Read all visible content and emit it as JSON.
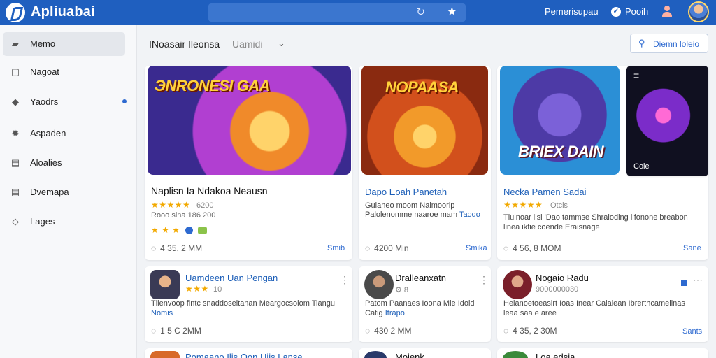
{
  "app": {
    "title": "Apliuabai"
  },
  "header": {
    "search_placeholder": "",
    "link1": "Pemerisupau",
    "link2": "Pooih"
  },
  "sidebar": {
    "items": [
      {
        "label": "Memo",
        "icon": "store-icon",
        "glyph": "▰",
        "active": true
      },
      {
        "label": "Nagoat",
        "icon": "window-icon",
        "glyph": "▢"
      },
      {
        "label": "Yaodrs",
        "icon": "tag-icon",
        "glyph": "◆"
      },
      {
        "label": "Aspaden",
        "icon": "settings-icon",
        "glyph": "✹"
      },
      {
        "label": "Aloalies",
        "icon": "lock-icon",
        "glyph": "▤"
      },
      {
        "label": "Dvemapa",
        "icon": "document-icon",
        "glyph": "▤"
      },
      {
        "label": "Lages",
        "icon": "tag-outline-icon",
        "glyph": "◇"
      }
    ]
  },
  "toolbar": {
    "title": "INoasair Ileonsa",
    "select_value": "Uamidi",
    "button_label": "Diemn loleio"
  },
  "featured": [
    {
      "banner_text": "ЭNRONESI GAA",
      "title": "Naplisn Ia Ndakoa Neausn",
      "title_style": "dark",
      "stars": "★★★★★",
      "rating": "6200",
      "subtitle": "Rooo sina 186 200",
      "extra_stars": "★ ★ ★",
      "stats": "4 35, 2 MM",
      "action": "Smib"
    },
    {
      "banner_text": "NOPAASA",
      "title": "Dapo Eoah Panetah",
      "title_style": "blue",
      "desc": "Gulaneo moom Naimoorip Palolenomme naaroe mam",
      "link": "Taodo",
      "stats": "4200 Min",
      "action": "Smika"
    },
    {
      "banner_text": "BRIEX DAIN",
      "title": "Necka Pamen Sadai",
      "title_style": "blue",
      "stars": "★★★★★",
      "rating": "Otcis",
      "desc": "Tluinoar lisi 'Dao tammse Shraloding lifonone breabon linea ikfie coende Eraisnage",
      "stats": "4 56, 8 MOM",
      "action": "Sane"
    },
    {
      "corner_text": "Coie"
    }
  ],
  "list": [
    {
      "title": "Uamdeen Uan Pengan",
      "stars": "★★★",
      "rating": "10",
      "desc": "Tlienvoop fintc snaddoseitanan Meargocsoiom Tiangu",
      "link": "Nomis",
      "stats": "1 5 C 2MM"
    },
    {
      "title": "Dralleanxatn",
      "rating": "8",
      "desc": "Patom Paanaes Ioona Mie Idoid Catig",
      "link": "Itrapo",
      "stats": "430 2 MM"
    },
    {
      "title": "Nogaio Radu",
      "rating": "9000000030",
      "desc": "Helanoetoeasirt Ioas Inear Caialean Ibrerthcamelinas leaa saa e aree",
      "stats": "4 35, 2 30M",
      "action": "Sants"
    }
  ],
  "partial": [
    {
      "title": "Pomaano Ilis Oon Hiis Lanse"
    },
    {
      "title": "Moienk"
    },
    {
      "title": "Loa edsia"
    }
  ]
}
